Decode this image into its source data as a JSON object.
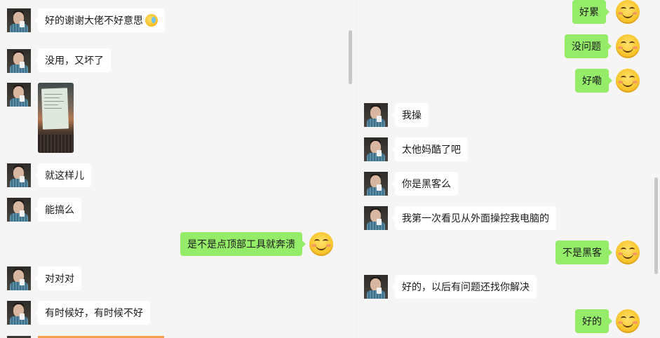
{
  "left_chat": {
    "messages": [
      {
        "side": "in",
        "type": "text",
        "text": "好的谢谢大佬不好意思",
        "emoji": "face-with-tears-emoji"
      },
      {
        "side": "in",
        "type": "text",
        "text": "没用，又坏了"
      },
      {
        "side": "in",
        "type": "image",
        "image": "laptop-screen-photo"
      },
      {
        "side": "in",
        "type": "text",
        "text": "就这样儿"
      },
      {
        "side": "in",
        "type": "text",
        "text": "能搞么"
      },
      {
        "side": "out",
        "type": "text",
        "text": "是不是点顶部工具就奔溃"
      },
      {
        "side": "in",
        "type": "text",
        "text": "对对对"
      },
      {
        "side": "in",
        "type": "text",
        "text": "有时候好，有时候不好"
      }
    ]
  },
  "right_chat": {
    "messages": [
      {
        "side": "out",
        "type": "text",
        "text": "好累"
      },
      {
        "side": "out",
        "type": "text",
        "text": "没问题"
      },
      {
        "side": "out",
        "type": "text",
        "text": "好嘞"
      },
      {
        "side": "in",
        "type": "text",
        "text": "我操"
      },
      {
        "side": "in",
        "type": "text",
        "text": "太他妈酷了吧"
      },
      {
        "side": "in",
        "type": "text",
        "text": "你是黑客么"
      },
      {
        "side": "in",
        "type": "text",
        "text": "我第一次看见从外面操控我电脑的"
      },
      {
        "side": "out",
        "type": "text",
        "text": "不是黑客"
      },
      {
        "side": "in",
        "type": "text",
        "text": "好的，以后有问题还找你解决"
      },
      {
        "side": "out",
        "type": "text",
        "text": "好的"
      }
    ]
  },
  "colors": {
    "background": "#f5f5f5",
    "incoming_bubble": "#ffffff",
    "outgoing_bubble": "#95ec69",
    "scrollbar": "#c8c8c8"
  }
}
